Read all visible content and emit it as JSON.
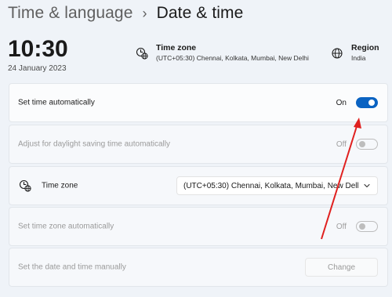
{
  "header": {
    "parent": "Time & language",
    "separator": "›",
    "current": "Date & time"
  },
  "clock": {
    "time": "10:30",
    "date": "24 January 2023"
  },
  "summary": {
    "timezone": {
      "title": "Time zone",
      "value": "(UTC+05:30) Chennai, Kolkata, Mumbai, New Delhi",
      "icon": "clock-globe-icon"
    },
    "region": {
      "title": "Region",
      "value": "India",
      "icon": "globe-icon"
    }
  },
  "settings": {
    "set_time_auto": {
      "label": "Set time automatically",
      "state": "On"
    },
    "daylight_saving": {
      "label": "Adjust for daylight saving time automatically",
      "state": "Off"
    },
    "timezone": {
      "label": "Time zone",
      "value": "(UTC+05:30) Chennai, Kolkata, Mumbai, New Delhi",
      "icon": "clock-globe-icon"
    },
    "set_timezone_auto": {
      "label": "Set time zone automatically",
      "state": "Off"
    },
    "manual": {
      "label": "Set the date and time manually",
      "button": "Change"
    }
  },
  "colors": {
    "accent": "#0a63c2",
    "annotation": "#e0201f",
    "background": "#eff3f8"
  }
}
